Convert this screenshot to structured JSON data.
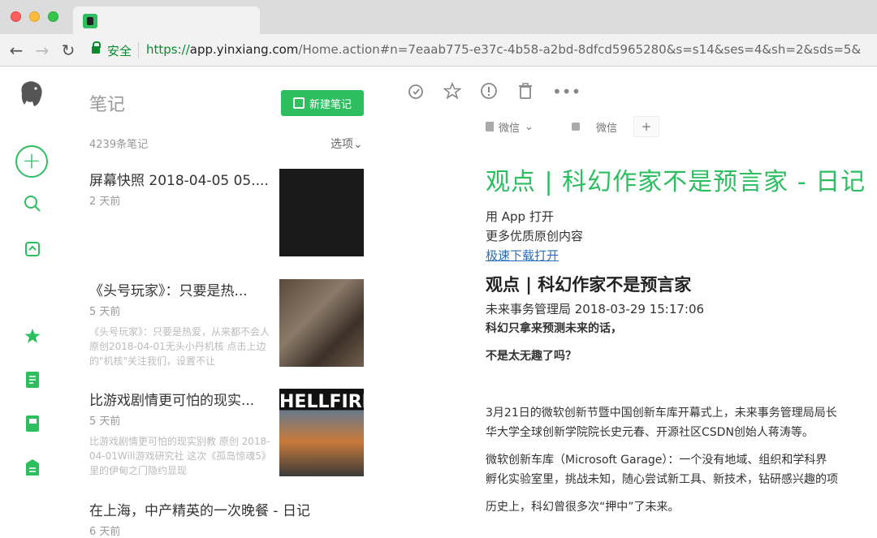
{
  "browser": {
    "tab_title": "",
    "secure_label": "安全",
    "url_scheme": "https://",
    "url_host": "app.yinxiang.com",
    "url_path": "/Home.action#n=7eaab775-e37c-4b58-a2bd-8dfcd5965280&s=s14&ses=4&sh=2&sds=5&"
  },
  "sidebar": {
    "icons": [
      "elephant-logo",
      "new-note-plus",
      "search",
      "share",
      "shortcuts-star",
      "notes",
      "notebooks",
      "work-chat"
    ]
  },
  "notelist": {
    "title": "笔记",
    "new_note_label": "新建笔记",
    "count": "4239条笔记",
    "options_label": "选项",
    "notes": [
      {
        "title": "屏幕快照 2018-04-05 05....",
        "date": "2 天前",
        "snippet": ""
      },
      {
        "title": "《头号玩家》：只要是热...",
        "date": "5 天前",
        "snippet": "《头号玩家》：只要是热爱，从来都不会人 原创2018-04-01无头小丹机核 点击上边的\"机核\"关注我们，设置不让"
      },
      {
        "title": "比游戏剧情更可怕的现实...",
        "date": "5 天前",
        "snippet": "比游戏剧情更可怕的现实别教 原创 2018-04-01Will游戏研究社 这次《孤岛惊魂5》里的伊甸之门隐约显现"
      },
      {
        "title": "在上海，中产精英的一次晚餐 - 日记",
        "date": "6 天前",
        "snippet": ""
      }
    ],
    "thumb3_text": "HELLFIRE"
  },
  "editor": {
    "notebook": "微信",
    "tag": "微信",
    "add_tag": "+",
    "title": "观点 | 科幻作家不是预言家 - 日记",
    "open_app": "用 App 打开",
    "more_content": "更多优质原创内容",
    "download_link": "极速下载打开",
    "heading": "观点 | 科幻作家不是预言家",
    "meta": "未来事务管理局 2018-03-29 15:17:06",
    "bold1": "科幻只拿来预测未来的话，",
    "bold2": "不是太无趣了吗？",
    "p1a": "3月21日的微软创新节暨中国创新车库开幕式上，未来事务管理局局长",
    "p1b": "华大学全球创新学院院长史元春、开源社区CSDN创始人蒋涛等。",
    "p2a": "微软创新车库（Microsoft Garage）：一个没有地域、组织和学科界",
    "p2b": "孵化实验室里，挑战未知，随心尝试新工具、新技术，钻研感兴趣的项",
    "p3": "历史上，科幻曾很多次“押中”了未来。"
  },
  "colors": {
    "accent": "#2dbe60",
    "link": "#2a6ebb"
  }
}
